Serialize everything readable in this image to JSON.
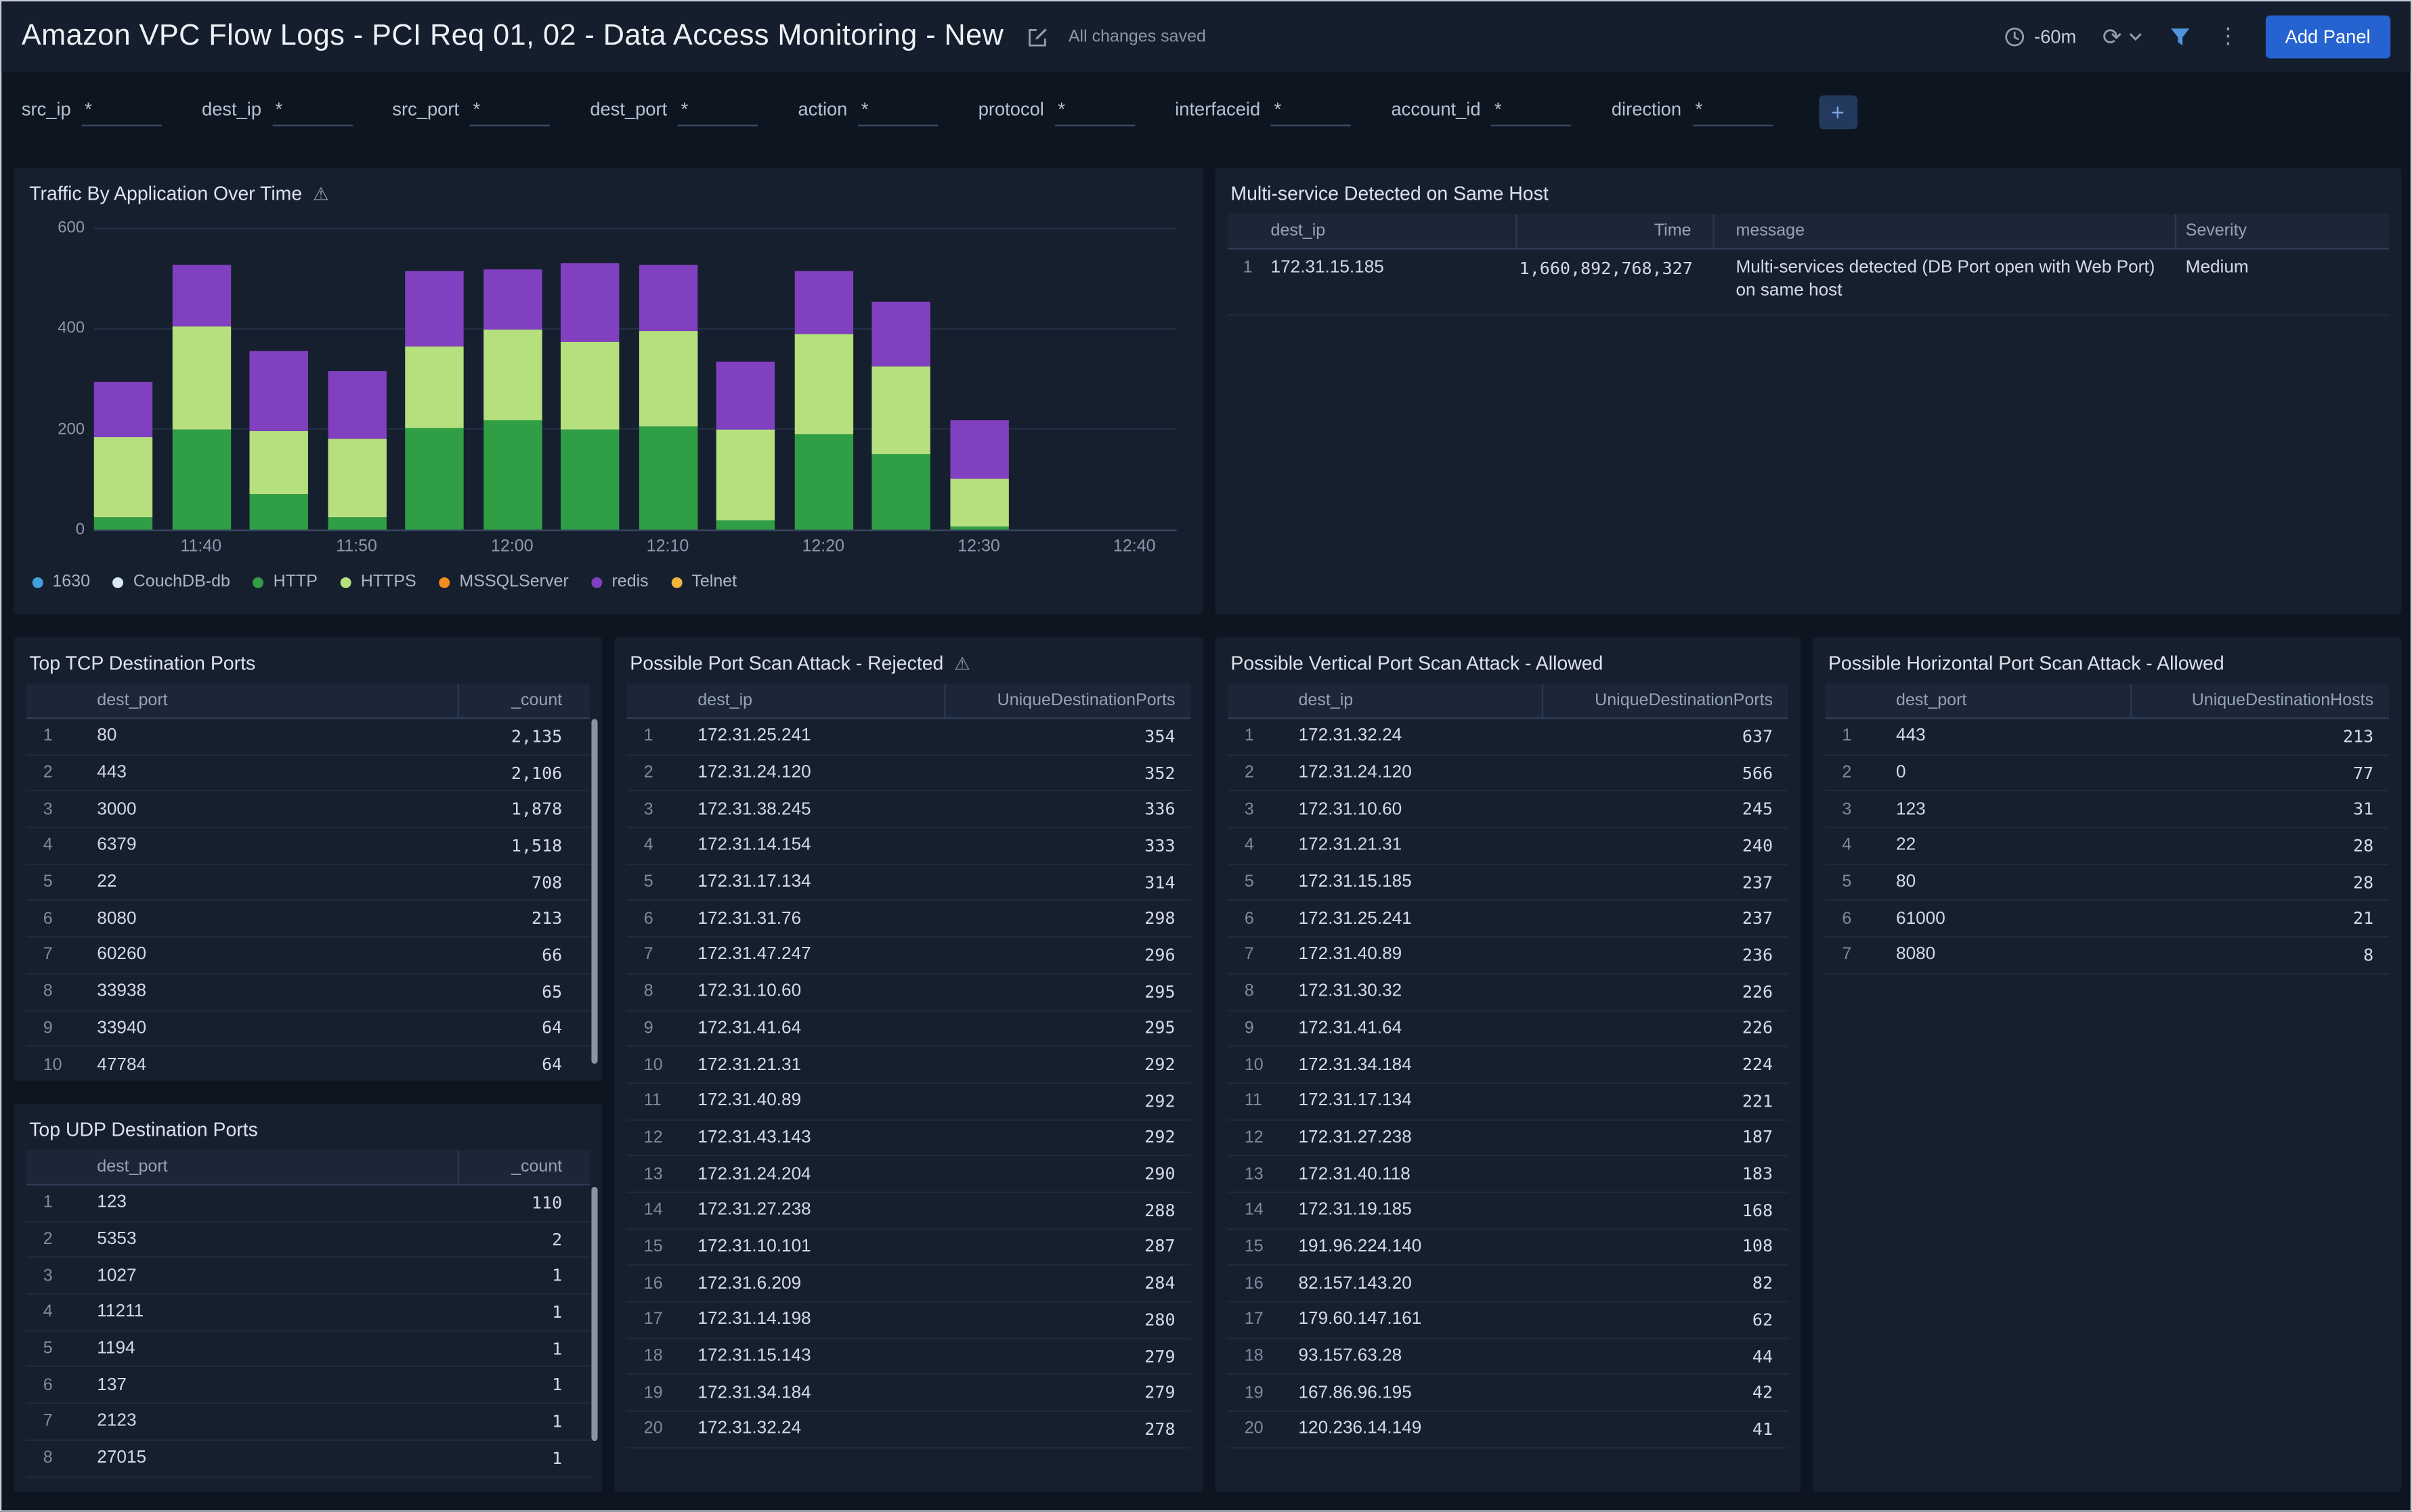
{
  "header": {
    "title": "Amazon VPC Flow Logs - PCI Req 01, 02 - Data Access Monitoring - New",
    "saved_status": "All changes saved",
    "time_range": "-60m",
    "add_panel_label": "Add Panel"
  },
  "icons": {
    "warning": "⚠",
    "refresh": "⟳",
    "kebab": "⋮",
    "add_filter": "+"
  },
  "filters": {
    "value": "*",
    "fields": [
      "src_ip",
      "dest_ip",
      "src_port",
      "dest_port",
      "action",
      "protocol",
      "interfaceid",
      "account_id",
      "direction"
    ]
  },
  "panels": {
    "traffic": {
      "title": "Traffic By Application Over Time",
      "chart_data": {
        "type": "bar",
        "stacked": true,
        "title": "Traffic By Application Over Time",
        "x": [
          "11:35",
          "11:40",
          "11:45",
          "11:50",
          "11:55",
          "12:00",
          "12:05",
          "12:10",
          "12:15",
          "12:20",
          "12:25",
          "12:30"
        ],
        "x_tick_labels": [
          "11:40",
          "11:50",
          "12:00",
          "12:10",
          "12:20",
          "12:30",
          "12:40"
        ],
        "ylim": [
          0,
          600
        ],
        "yticks": [
          0,
          200,
          400,
          600
        ],
        "legend_position": "bottom",
        "series": [
          {
            "name": "1630",
            "color": "#41a0dc",
            "values": [
              0,
              0,
              0,
              0,
              0,
              0,
              0,
              0,
              0,
              0,
              0,
              0
            ]
          },
          {
            "name": "CouchDB-db",
            "color": "#d8e9f6",
            "values": [
              0,
              0,
              0,
              0,
              0,
              0,
              0,
              0,
              0,
              0,
              0,
              0
            ]
          },
          {
            "name": "HTTP",
            "color": "#2f9e44",
            "values": [
              25,
              200,
              70,
              25,
              203,
              218,
              200,
              206,
              18,
              190,
              150,
              6
            ]
          },
          {
            "name": "HTTPS",
            "color": "#b6df7e",
            "values": [
              160,
              205,
              125,
              155,
              160,
              180,
              175,
              190,
              182,
              200,
              175,
              95
            ]
          },
          {
            "name": "MSSQLServer",
            "color": "#ef8e1f",
            "values": [
              0,
              0,
              0,
              0,
              0,
              0,
              0,
              0,
              0,
              0,
              0,
              0
            ]
          },
          {
            "name": "redis",
            "color": "#8040bf",
            "values": [
              110,
              122,
              160,
              135,
              150,
              118,
              155,
              130,
              135,
              123,
              127,
              117
            ]
          },
          {
            "name": "Telnet",
            "color": "#f2b43c",
            "values": [
              0,
              0,
              0,
              0,
              0,
              0,
              0,
              0,
              0,
              0,
              0,
              0
            ]
          }
        ]
      }
    },
    "multi_service": {
      "title": "Multi-service Detected on Same Host",
      "columns": [
        "dest_ip",
        "Time",
        "message",
        "Severity"
      ],
      "rows": [
        [
          "172.31.15.185",
          "1,660,892,768,327",
          "Multi-services detected (DB Port open with Web Port) on same host",
          "Medium"
        ]
      ]
    },
    "top_tcp": {
      "title": "Top TCP Destination Ports",
      "columns": [
        "dest_port",
        "_count"
      ],
      "rows": [
        [
          "80",
          "2,135"
        ],
        [
          "443",
          "2,106"
        ],
        [
          "3000",
          "1,878"
        ],
        [
          "6379",
          "1,518"
        ],
        [
          "22",
          "708"
        ],
        [
          "8080",
          "213"
        ],
        [
          "60260",
          "66"
        ],
        [
          "33938",
          "65"
        ],
        [
          "33940",
          "64"
        ],
        [
          "47784",
          "64"
        ]
      ]
    },
    "port_scan_rejected": {
      "title": "Possible Port Scan Attack - Rejected",
      "columns": [
        "dest_ip",
        "UniqueDestinationPorts"
      ],
      "rows": [
        [
          "172.31.25.241",
          "354"
        ],
        [
          "172.31.24.120",
          "352"
        ],
        [
          "172.31.38.245",
          "336"
        ],
        [
          "172.31.14.154",
          "333"
        ],
        [
          "172.31.17.134",
          "314"
        ],
        [
          "172.31.31.76",
          "298"
        ],
        [
          "172.31.47.247",
          "296"
        ],
        [
          "172.31.10.60",
          "295"
        ],
        [
          "172.31.41.64",
          "295"
        ],
        [
          "172.31.21.31",
          "292"
        ],
        [
          "172.31.40.89",
          "292"
        ],
        [
          "172.31.43.143",
          "292"
        ],
        [
          "172.31.24.204",
          "290"
        ],
        [
          "172.31.27.238",
          "288"
        ],
        [
          "172.31.10.101",
          "287"
        ],
        [
          "172.31.6.209",
          "284"
        ],
        [
          "172.31.14.198",
          "280"
        ],
        [
          "172.31.15.143",
          "279"
        ],
        [
          "172.31.34.184",
          "279"
        ],
        [
          "172.31.32.24",
          "278"
        ]
      ]
    },
    "vertical_scan": {
      "title": "Possible Vertical Port Scan Attack - Allowed",
      "columns": [
        "dest_ip",
        "UniqueDestinationPorts"
      ],
      "rows": [
        [
          "172.31.32.24",
          "637"
        ],
        [
          "172.31.24.120",
          "566"
        ],
        [
          "172.31.10.60",
          "245"
        ],
        [
          "172.31.21.31",
          "240"
        ],
        [
          "172.31.15.185",
          "237"
        ],
        [
          "172.31.25.241",
          "237"
        ],
        [
          "172.31.40.89",
          "236"
        ],
        [
          "172.31.30.32",
          "226"
        ],
        [
          "172.31.41.64",
          "226"
        ],
        [
          "172.31.34.184",
          "224"
        ],
        [
          "172.31.17.134",
          "221"
        ],
        [
          "172.31.27.238",
          "187"
        ],
        [
          "172.31.40.118",
          "183"
        ],
        [
          "172.31.19.185",
          "168"
        ],
        [
          "191.96.224.140",
          "108"
        ],
        [
          "82.157.143.20",
          "82"
        ],
        [
          "179.60.147.161",
          "62"
        ],
        [
          "93.157.63.28",
          "44"
        ],
        [
          "167.86.96.195",
          "42"
        ],
        [
          "120.236.14.149",
          "41"
        ]
      ]
    },
    "horizontal_scan": {
      "title": "Possible Horizontal Port Scan Attack - Allowed",
      "columns": [
        "dest_port",
        "UniqueDestinationHosts"
      ],
      "rows": [
        [
          "443",
          "213"
        ],
        [
          "0",
          "77"
        ],
        [
          "123",
          "31"
        ],
        [
          "22",
          "28"
        ],
        [
          "80",
          "28"
        ],
        [
          "61000",
          "21"
        ],
        [
          "8080",
          "8"
        ]
      ]
    },
    "top_udp": {
      "title": "Top UDP Destination Ports",
      "columns": [
        "dest_port",
        "_count"
      ],
      "rows": [
        [
          "123",
          "110"
        ],
        [
          "5353",
          "2"
        ],
        [
          "1027",
          "1"
        ],
        [
          "11211",
          "1"
        ],
        [
          "1194",
          "1"
        ],
        [
          "137",
          "1"
        ],
        [
          "2123",
          "1"
        ],
        [
          "27015",
          "1"
        ]
      ]
    }
  }
}
